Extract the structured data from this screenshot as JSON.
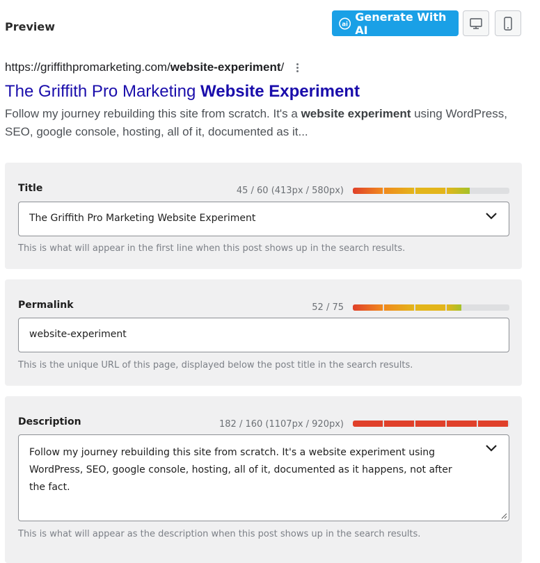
{
  "header": {
    "preview_label": "Preview",
    "generate_button_label": "Generate With AI"
  },
  "icons": {
    "ai": "ai-sparkle-icon",
    "desktop": "desktop-icon",
    "mobile": "mobile-icon",
    "more": "more-vertical-icon",
    "chevron": "chevron-down-icon"
  },
  "serp": {
    "url_base": "https://griffithpromarketing.com/",
    "url_slug": "website-experiment",
    "url_trailing": "/",
    "title_plain": "The Griffith Pro Marketing ",
    "title_bold": "Website Experiment",
    "desc_before": "Follow my journey rebuilding this site from scratch. It's a ",
    "desc_bold": "website experiment",
    "desc_after": " using WordPress, SEO, google console, hosting, all of it, documented as it..."
  },
  "fields": {
    "title": {
      "label": "Title",
      "counter": "45 / 60 (413px / 580px)",
      "value": "The Griffith Pro Marketing Website Experiment",
      "help": "This is what will appear in the first line when this post shows up in the search results.",
      "meter_filled_segments": 4
    },
    "permalink": {
      "label": "Permalink",
      "counter": "52 / 75",
      "value": "website-experiment",
      "help": "This is the unique URL of this page, displayed below the post title in the search results.",
      "meter_filled_segments": 4
    },
    "description": {
      "label": "Description",
      "counter": "182 / 160 (1107px / 920px)",
      "value": "Follow my journey rebuilding this site from scratch. It's a website experiment using WordPress, SEO, google console, hosting, all of it, documented as it happens, not after the fact.",
      "help": "This is what will appear as the description when this post shows up in the search results.",
      "meter_filled_segments": 5
    }
  },
  "colors": {
    "accent": "#1aa0e6",
    "link": "#1a0dab",
    "meter_red": "#e0402a",
    "meter_orange": "#f08a1e",
    "meter_yellow": "#e3b51b",
    "meter_green": "#a5c22a",
    "meter_track": "#dedfe1"
  }
}
